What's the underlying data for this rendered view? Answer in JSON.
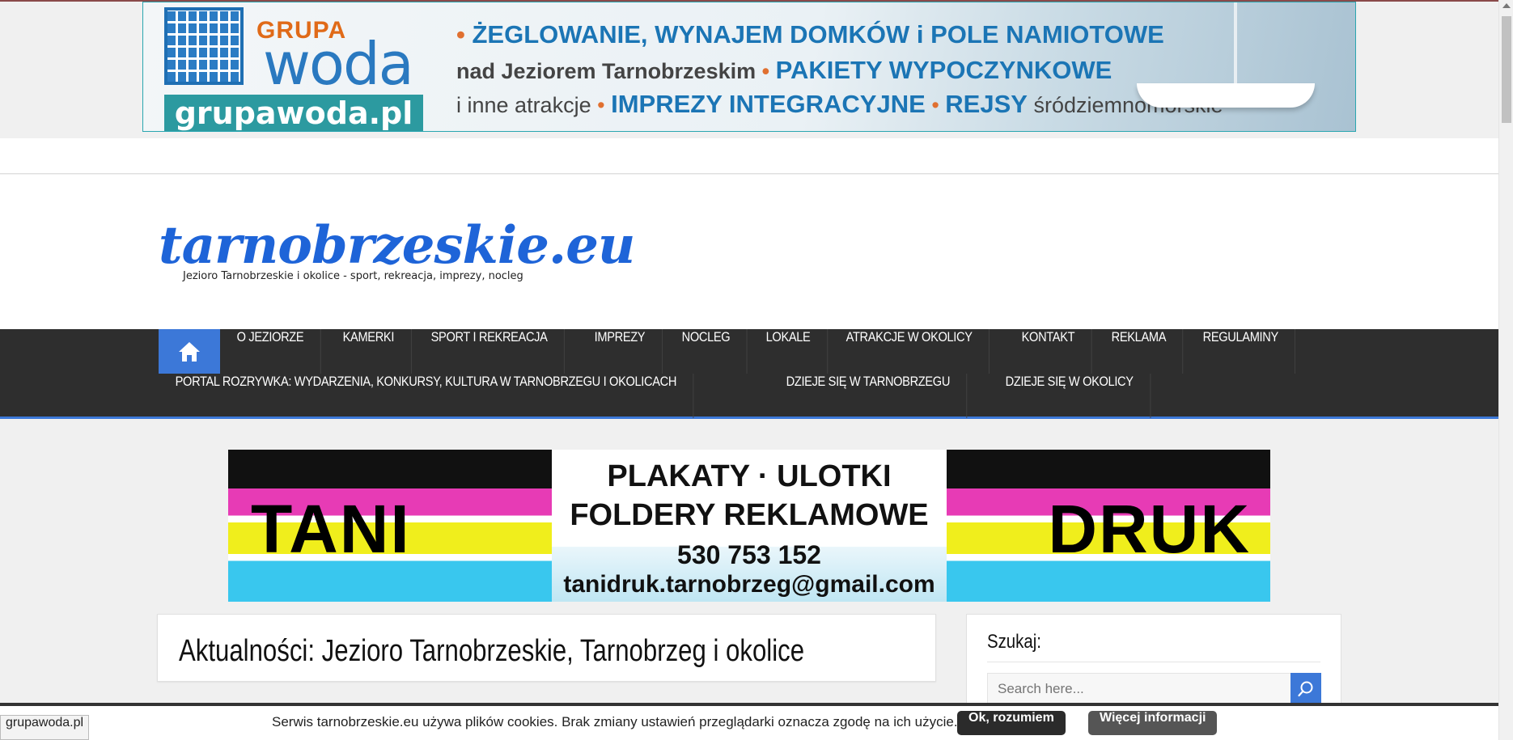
{
  "top_banner": {
    "logo_grupa": "GRUPA",
    "logo_woda": "woda",
    "url": "grupawoda.pl",
    "line1_a": "•",
    "line1_b": "ŻEGLOWANIE, WYNAJEM DOMKÓW i POLE NAMIOTOWE",
    "line2_a": "nad Jeziorem Tarnobrzeskim",
    "line2_b": "•",
    "line2_c": "PAKIETY WYPOCZYNKOWE",
    "line3_a": "i inne atrakcje",
    "line3_b": "•",
    "line3_c": "IMPREZY INTEGRACYJNE",
    "line3_d": "•",
    "line3_e": "REJSY",
    "line3_f": "śródziemnomorskie"
  },
  "header": {
    "logo": "tarnobrzeskie.eu",
    "tagline": "Jezioro Tarnobrzeskie i okolice - sport, rekreacja, imprezy, nocleg"
  },
  "nav": {
    "home_icon": "home-icon",
    "row1": [
      "O JEZIORZE",
      "KAMERKI",
      "SPORT I REKREACJA",
      "IMPREZY",
      "NOCLEG",
      "LOKALE",
      "ATRAKCJE W OKOLICY",
      "KONTAKT",
      "REKLAMA",
      "REGULAMINY"
    ],
    "row2": [
      "PORTAL ROZRYWKA: WYDARZENIA, KONKURSY, KULTURA W TARNOBRZEGU I OKOLICACH",
      "DZIEJE SIĘ W TARNOBRZEGU",
      "DZIEJE SIĘ W OKOLICY"
    ],
    "active_color": "#3c78d8"
  },
  "ad_banner": {
    "left": "TANI",
    "right": "DRUK",
    "line1": "PLAKATY · ULOTKI",
    "line2": "FOLDERY REKLAMOWE",
    "phone": "530 753 152",
    "email": "tanidruk.tarnobrzeg@gmail.com"
  },
  "main": {
    "title": "Aktualności: Jezioro Tarnobrzeskie, Tarnobrzeg i okolice"
  },
  "sidebar": {
    "search_title": "Szukaj:",
    "search_placeholder": "Search here...",
    "search_icon": "search-icon"
  },
  "cookie_bar": {
    "text": "Serwis tarnobrzeskie.eu używa plików cookies. Brak zmiany ustawień przeglądarki oznacza zgodę na ich użycie.",
    "ok_label": "Ok, rozumiem",
    "more_label": "Więcej informacji"
  },
  "status_bar": {
    "url": "grupawoda.pl"
  }
}
